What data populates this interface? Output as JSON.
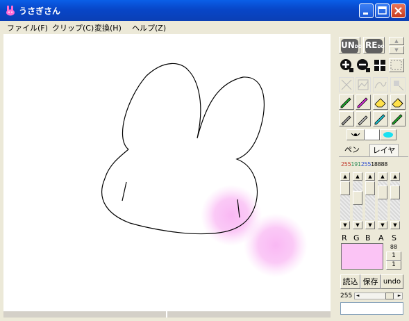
{
  "window": {
    "title": "うさぎさん"
  },
  "menu": {
    "items": [
      "ファイル(F)",
      "クリップ(C)",
      "変換(H)",
      "ヘルプ(Z)"
    ]
  },
  "toolbar": {
    "undo_label": "UN",
    "undo_sub": "DO",
    "redo_label": "RE",
    "redo_sub": "DO"
  },
  "tabs": {
    "pen": "ペン",
    "layer": "レイヤ"
  },
  "channels": {
    "values": [
      "255",
      "191",
      "255",
      "188",
      "88"
    ],
    "value_colors": [
      "#C0392B",
      "#2E8B57",
      "#2E4FD0",
      "#000000",
      "#000000"
    ],
    "labels": [
      "R",
      "G",
      "B",
      "A",
      "S"
    ]
  },
  "color_preview": "#FBC4F5",
  "stepper": {
    "value": "88",
    "a": "1",
    "b": "1"
  },
  "actions": {
    "load": "読込",
    "save": "保存",
    "undo": "undo"
  },
  "bottom_slider": {
    "value": "255"
  },
  "colors": {
    "title_bar": "#0A55E0",
    "chrome": "#ECE9D8",
    "canvas": "#FFFFFF",
    "brush": "#FAC0F5"
  }
}
